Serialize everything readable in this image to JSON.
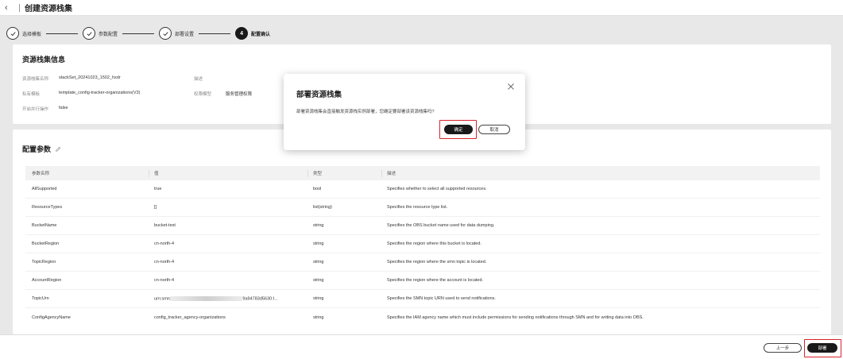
{
  "header": {
    "back_icon": "chevron-left-icon",
    "title": "创建资源栈集"
  },
  "steps": [
    {
      "label": "选择模板",
      "state": "done"
    },
    {
      "label": "参数配置",
      "state": "done"
    },
    {
      "label": "部署设置",
      "state": "done"
    },
    {
      "number": "4",
      "label": "配置确认",
      "state": "active"
    }
  ],
  "info": {
    "title": "资源栈集信息",
    "name_label": "资源栈集名称",
    "name_value": "stackSet_20241023_1502_hxdr",
    "desc_label": "描述",
    "template_label": "私有模板",
    "template_value": "template_config-tracker-organizations(V3)",
    "permission_label": "权限模型",
    "permission_value": "服务管理权限",
    "parallel_label": "开启并行操作",
    "parallel_value": "false"
  },
  "params": {
    "title": "配置参数",
    "edit_icon": "pencil-icon",
    "columns": [
      "参数名称",
      "值",
      "类型",
      "描述"
    ],
    "rows": [
      {
        "name": "AllSupported",
        "value": "true",
        "type": "bool",
        "desc": "Specifies whether to select all supported resources."
      },
      {
        "name": "ResourceTypes",
        "value": "[]",
        "type": "list(string)",
        "desc": "Specifies the resource type list."
      },
      {
        "name": "BucketName",
        "value": "bucket-test",
        "type": "string",
        "desc": "Specifies the OBS bucket name used for data dumping."
      },
      {
        "name": "BucketRegion",
        "value": "cn-north-4",
        "type": "string",
        "desc": "Specifies the region where this bucket is located."
      },
      {
        "name": "TopicRegion",
        "value": "cn-north-4",
        "type": "string",
        "desc": "Specifies the region where the smn topic is located."
      },
      {
        "name": "AccountRegion",
        "value": "cn-north-4",
        "type": "string",
        "desc": "Specifies the region where the account is located."
      },
      {
        "name": "TopicUrn",
        "value_prefix": "urn:smn:",
        "value_suffix": "9a94783d5630:I...",
        "type": "string",
        "desc": "Specifies the SMN topic URN used to send notifications."
      },
      {
        "name": "ConfigAgencyName",
        "value": "config_tracker_agency-organizations",
        "type": "string",
        "desc": "Specifies the IAM agency name which must include permissions for sending notifications through SMN and for writing data into OBS."
      }
    ]
  },
  "footer": {
    "prev_label": "上一步",
    "deploy_label": "部署"
  },
  "dialog": {
    "title": "部署资源栈集",
    "message": "部署资源栈集会直接触发资源栈实例部署，您确定要部署该资源栈集吗?",
    "confirm_label": "确定",
    "cancel_label": "取消",
    "close_icon": "close-icon"
  },
  "colors": {
    "primary": "#191919",
    "highlight": "#d8232a",
    "background": "#e8e8e8"
  }
}
